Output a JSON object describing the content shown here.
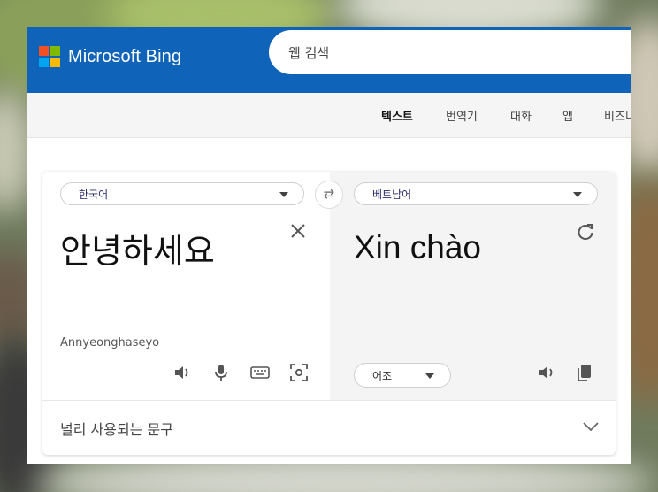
{
  "header": {
    "brand": "Microsoft Bing",
    "logo_colors": [
      "#f25022",
      "#7fba00",
      "#00a4ef",
      "#ffb900"
    ]
  },
  "search": {
    "placeholder": "웹 검색"
  },
  "nav": {
    "tabs": [
      {
        "label": "텍스트",
        "active": true
      },
      {
        "label": "번역기",
        "active": false
      },
      {
        "label": "대화",
        "active": false
      },
      {
        "label": "앱",
        "active": false
      },
      {
        "label": "비즈니",
        "active": false
      }
    ]
  },
  "translator": {
    "source_lang": "한국어",
    "target_lang": "베트남어",
    "source_text": "안녕하세요",
    "transliteration": "Annyeonghaseyo",
    "target_text": "Xin chào",
    "tone_label": "어조",
    "swap_icon": "swap-icon",
    "clear_icon": "close-icon",
    "refresh_icon": "refresh-icon"
  },
  "phrases": {
    "label": "널리 사용되는 문구"
  },
  "colors": {
    "header_bg": "#0f64b9",
    "subnav_bg": "#f5f5f5",
    "target_pane_bg": "#f4f4f4"
  }
}
